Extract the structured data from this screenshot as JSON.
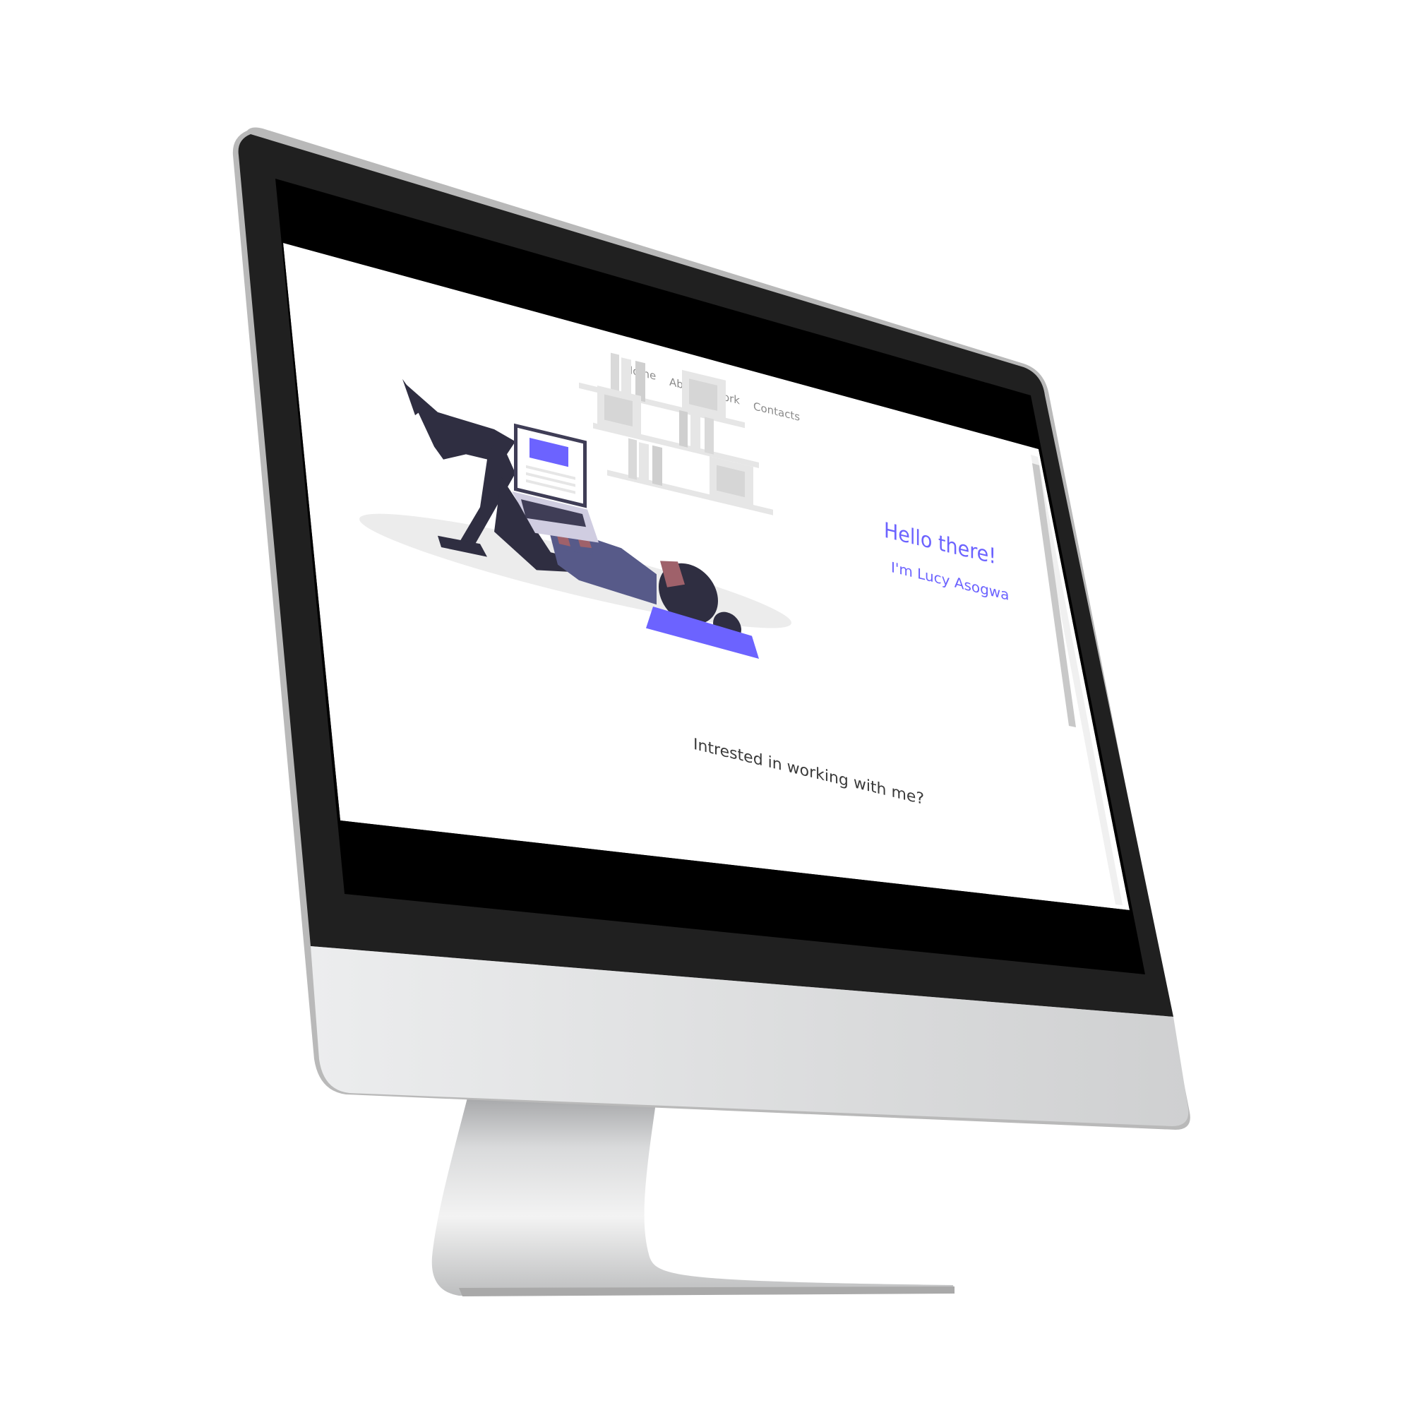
{
  "nav": {
    "items": [
      "Home",
      "About",
      "Work",
      "Contacts"
    ]
  },
  "hero": {
    "greeting": "Hello there!",
    "intro": "I'm Lucy Asogwa"
  },
  "cta": {
    "text": "Intrested in working with me?"
  },
  "colors": {
    "accent": "#6c63ff",
    "ink": "#2f2e41",
    "shelf": "#e6e6e6",
    "bezel": "#1f1f1f",
    "screen_black": "#000000",
    "chin_light": "#e9eaea",
    "chin_dark": "#c9c9c9"
  }
}
